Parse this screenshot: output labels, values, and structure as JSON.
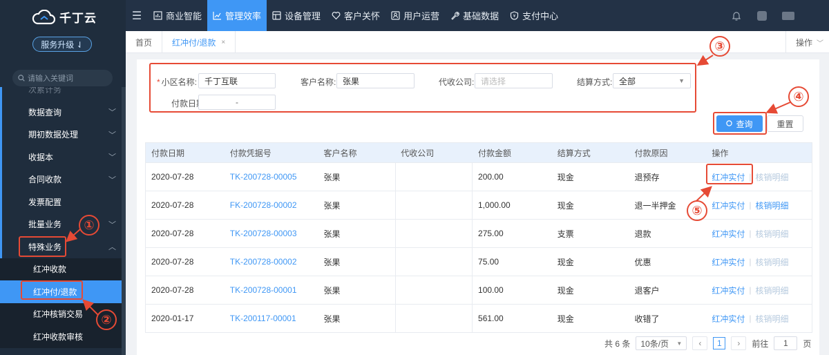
{
  "brand": {
    "name": "千丁云",
    "upgrade_label": "服务升级 ⇃"
  },
  "search": {
    "placeholder": "请输入关键词"
  },
  "sidebar": {
    "cut_item": "次累计务",
    "items": [
      {
        "label": "数据查询",
        "expanded": false
      },
      {
        "label": "期初数据处理",
        "expanded": false
      },
      {
        "label": "收据本",
        "expanded": false
      },
      {
        "label": "合同收款",
        "expanded": false
      },
      {
        "label": "发票配置",
        "expanded": null
      },
      {
        "label": "批量业务",
        "expanded": false
      },
      {
        "label": "特殊业务",
        "expanded": true
      }
    ],
    "sub_items": [
      {
        "label": "红冲收款",
        "active": false
      },
      {
        "label": "红冲付/退款",
        "active": true
      },
      {
        "label": "红冲核销交易",
        "active": false
      },
      {
        "label": "红冲收款审核",
        "active": false
      }
    ]
  },
  "topnav": {
    "items": [
      {
        "label": "商业智能",
        "icon": "chart-icon"
      },
      {
        "label": "管理效率",
        "icon": "trend-icon",
        "active": true
      },
      {
        "label": "设备管理",
        "icon": "device-icon"
      },
      {
        "label": "客户关怀",
        "icon": "heart-icon"
      },
      {
        "label": "用户运营",
        "icon": "user-icon"
      },
      {
        "label": "基础数据",
        "icon": "wrench-icon"
      },
      {
        "label": "支付中心",
        "icon": "shield-icon"
      }
    ]
  },
  "tabs": {
    "home": "首页",
    "current": "红冲付/退款",
    "close": "×",
    "operate": "操作"
  },
  "filter": {
    "community_label": "小区名称:",
    "community_value": "千丁互联",
    "customer_label": "客户名称:",
    "customer_value": "张果",
    "collector_label": "代收公司:",
    "collector_placeholder": "请选择",
    "settle_label": "结算方式:",
    "settle_value": "全部",
    "date_label": "付款日期:",
    "date_value": "-"
  },
  "buttons": {
    "query": "查询",
    "reset": "重置"
  },
  "table": {
    "headers": [
      "付款日期",
      "付款凭据号",
      "客户名称",
      "代收公司",
      "付款金额",
      "结算方式",
      "付款原因",
      "操作"
    ],
    "op_primary": "红冲实付",
    "op_secondary": "核销明细",
    "rows": [
      {
        "date": "2020-07-28",
        "voucher": "TK-200728-00005",
        "customer": "张果",
        "collector": "",
        "amount": "200.00",
        "method": "现金",
        "reason": "退预存",
        "detail_enabled": false
      },
      {
        "date": "2020-07-28",
        "voucher": "FK-200728-00002",
        "customer": "张果",
        "collector": "",
        "amount": "1,000.00",
        "method": "现金",
        "reason": "退一半押金",
        "detail_enabled": true
      },
      {
        "date": "2020-07-28",
        "voucher": "TK-200728-00003",
        "customer": "张果",
        "collector": "",
        "amount": "275.00",
        "method": "支票",
        "reason": "退款",
        "detail_enabled": false
      },
      {
        "date": "2020-07-28",
        "voucher": "TK-200728-00002",
        "customer": "张果",
        "collector": "",
        "amount": "75.00",
        "method": "现金",
        "reason": "优惠",
        "detail_enabled": false
      },
      {
        "date": "2020-07-28",
        "voucher": "TK-200728-00001",
        "customer": "张果",
        "collector": "",
        "amount": "100.00",
        "method": "现金",
        "reason": "退客户",
        "detail_enabled": false
      },
      {
        "date": "2020-01-17",
        "voucher": "TK-200117-00001",
        "customer": "张果",
        "collector": "",
        "amount": "561.00",
        "method": "现金",
        "reason": "收错了",
        "detail_enabled": false
      }
    ]
  },
  "pager": {
    "total": "共 6 条",
    "page_size": "10条/页",
    "current": "1",
    "goto_label": "前往",
    "goto_value": "1",
    "page_unit": "页"
  },
  "annotations": [
    "①",
    "②",
    "③",
    "④",
    "⑤"
  ],
  "colors": {
    "primary": "#3f97f5",
    "sidebar": "#1f2d3d",
    "topnav": "#233246",
    "annotation": "#e64a35"
  }
}
